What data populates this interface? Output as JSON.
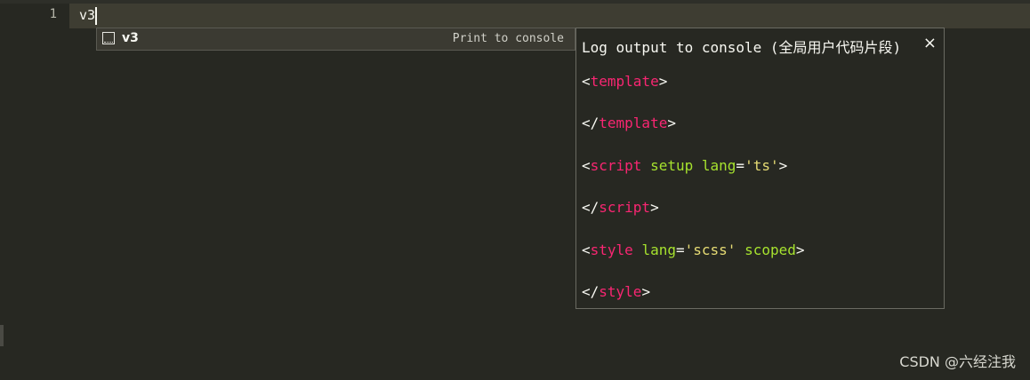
{
  "editor": {
    "line_number": "1",
    "line_text": "v3",
    "theme_colors": {
      "background": "#272822",
      "current_line": "#3e3d32",
      "tag": "#f92672",
      "attribute": "#a6e22e",
      "string": "#e6db74"
    }
  },
  "autocomplete": {
    "item": {
      "icon": "snippet-icon",
      "trigger": "v3",
      "annotation": "Print to console"
    }
  },
  "doc_panel": {
    "title": "Log output to console (全局用户代码片段)",
    "close_glyph": "×",
    "lines": [
      {
        "open": "<",
        "tag": "template",
        "close": ">"
      },
      {
        "open": "</",
        "tag": "template",
        "close": ">"
      },
      {
        "open": "<",
        "tag": "script",
        "attr1": "setup",
        "attr2": "lang",
        "eq": "=",
        "val": "'ts'",
        "close": ">"
      },
      {
        "open": "</",
        "tag": "script",
        "close": ">"
      },
      {
        "open": "<",
        "tag": "style",
        "attr1": "lang",
        "eq": "=",
        "val": "'scss'",
        "attr2": "scoped",
        "close": ">"
      },
      {
        "open": "</",
        "tag": "style",
        "close": ">"
      }
    ]
  },
  "watermark": "CSDN @六经注我"
}
